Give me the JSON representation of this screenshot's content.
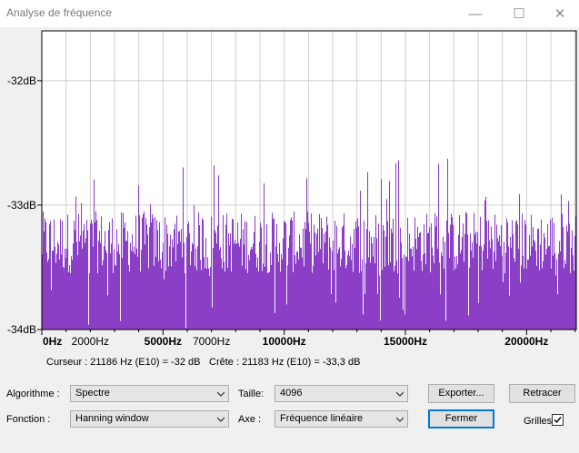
{
  "window": {
    "title": "Analyse de fréquence",
    "minimize_glyph": "—",
    "maximize_glyph": "☐",
    "close_glyph": "✕"
  },
  "chart_data": {
    "type": "area",
    "title": "",
    "xlabel": "",
    "ylabel": "",
    "color": "#8a3fc6",
    "xlim": [
      0,
      22050
    ],
    "ylim": [
      -34,
      -31.6
    ],
    "y_ticks": [
      {
        "value": -32,
        "label": "-32dB"
      },
      {
        "value": -33,
        "label": "-33dB"
      },
      {
        "value": -34,
        "label": "-34dB"
      }
    ],
    "x_ticks": [
      {
        "value": 0,
        "label": "0Hz",
        "bold": true
      },
      {
        "value": 2000,
        "label": "2000Hz",
        "bold": false
      },
      {
        "value": 5000,
        "label": "5000Hz",
        "bold": true
      },
      {
        "value": 7000,
        "label": "7000Hz",
        "bold": false
      },
      {
        "value": 10000,
        "label": "10000Hz",
        "bold": true
      },
      {
        "value": 15000,
        "label": "15000Hz",
        "bold": true
      },
      {
        "value": 20000,
        "label": "20000Hz",
        "bold": true
      }
    ],
    "grid": true,
    "signal": {
      "description": "broadband noise spectrum",
      "baseline_db": -33.3,
      "peak_range_db": [
        -32.6,
        -33.6
      ],
      "dip_range_db": [
        -33.4,
        -34.0
      ]
    }
  },
  "status": {
    "cursor": "Curseur : 21186 Hz (E10) = -32 dB",
    "peak": "Crête : 21183 Hz (E10) = -33,3 dB"
  },
  "controls": {
    "algorithm_label": "Algorithme :",
    "algorithm_value": "Spectre",
    "function_label": "Fonction :",
    "function_value": "Hanning window",
    "size_label": "Taille:",
    "size_value": "4096",
    "axis_label": "Axe :",
    "axis_value": "Fréquence linéaire",
    "export_label": "Exporter...",
    "close_label": "Fermer",
    "replot_label": "Retracer",
    "grids_label": "Grilles",
    "grids_checked": true
  }
}
